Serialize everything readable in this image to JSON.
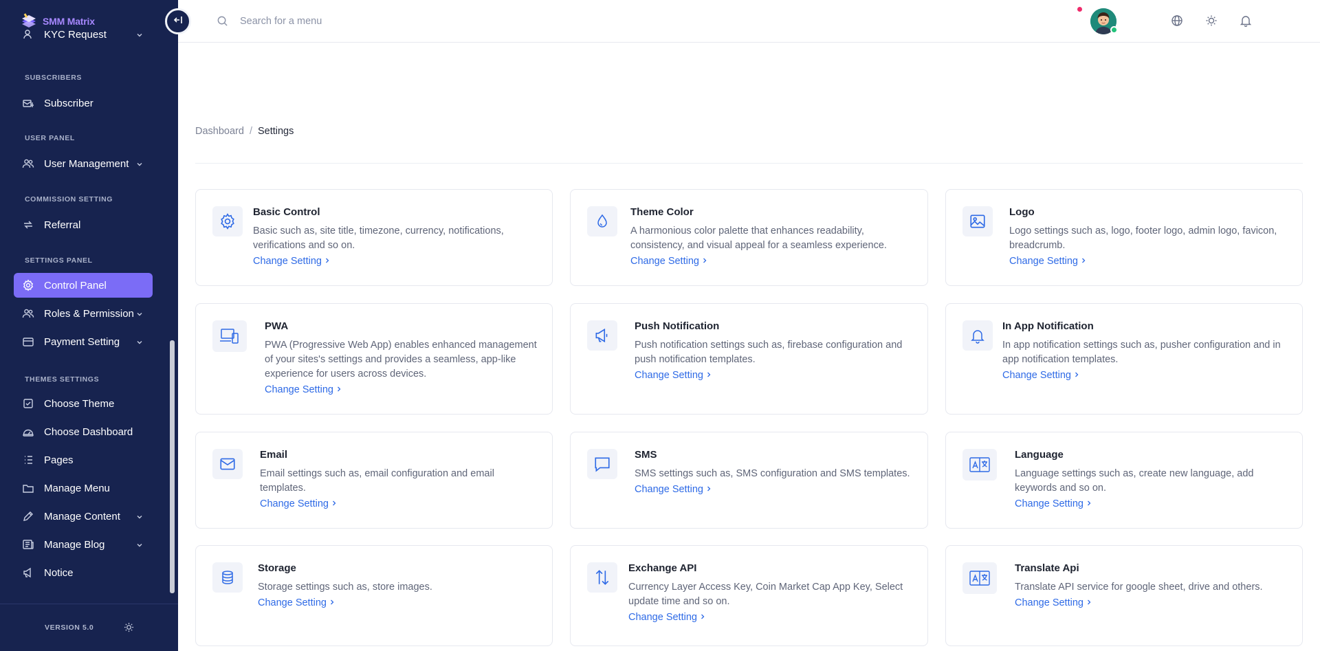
{
  "brand": {
    "name": "SMM Matrix"
  },
  "sidebar": {
    "partial_item": "KYC Request",
    "sections": [
      {
        "title": "SUBSCRIBERS"
      },
      {
        "title": "USER PANEL"
      },
      {
        "title": "COMMISSION SETTING"
      },
      {
        "title": "SETTINGS PANEL"
      },
      {
        "title": "THEMES SETTINGS"
      }
    ],
    "items": [
      {
        "label": "Subscriber",
        "icon": "subscriber-icon"
      },
      {
        "label": "User Management",
        "icon": "users-icon",
        "dropdown": true
      },
      {
        "label": "Referral",
        "icon": "referral-icon"
      },
      {
        "label": "Control Panel",
        "icon": "gear-icon",
        "active": true
      },
      {
        "label": "Roles & Permission",
        "icon": "roles-icon",
        "dropdown": true
      },
      {
        "label": "Payment Setting",
        "icon": "wallet-icon",
        "dropdown": true
      },
      {
        "label": "Choose Theme",
        "icon": "theme-icon"
      },
      {
        "label": "Choose Dashboard",
        "icon": "dashboard-icon"
      },
      {
        "label": "Pages",
        "icon": "pages-icon"
      },
      {
        "label": "Manage Menu",
        "icon": "folder-icon"
      },
      {
        "label": "Manage Content",
        "icon": "pencil-icon",
        "dropdown": true
      },
      {
        "label": "Manage Blog",
        "icon": "blog-icon",
        "dropdown": true
      },
      {
        "label": "Notice",
        "icon": "megaphone-icon"
      }
    ],
    "version": "VERSION 5.0"
  },
  "header": {
    "search_placeholder": "Search for a menu"
  },
  "breadcrumb": {
    "home": "Dashboard",
    "separator": "/",
    "current": "Settings"
  },
  "cards": [
    {
      "title": "Basic Control",
      "description": "Basic such as, site title, timezone, currency, notifications, verifications and so on.",
      "link": "Change Setting",
      "icon": "gear-icon"
    },
    {
      "title": "Theme Color",
      "description": "A harmonious color palette that enhances readability, consistency, and visual appeal for a seamless experience.",
      "link": "Change Setting",
      "icon": "droplet-icon"
    },
    {
      "title": "Logo",
      "description": "Logo settings such as, logo, footer logo, admin logo, favicon, breadcrumb.",
      "link": "Change Setting",
      "icon": "image-icon"
    },
    {
      "title": "PWA",
      "description": "PWA (Progressive Web App) enables enhanced management of your sites's settings and provides a seamless, app-like experience for users across devices.",
      "link": "Change Setting",
      "icon": "devices-icon"
    },
    {
      "title": "Push Notification",
      "description": "Push notification settings such as, firebase configuration and push notification templates.",
      "link": "Change Setting",
      "icon": "megaphone-icon"
    },
    {
      "title": "In App Notification",
      "description": "In app notification settings such as, pusher configuration and in app notification templates.",
      "link": "Change Setting",
      "icon": "bell-icon"
    },
    {
      "title": "Email",
      "description": "Email settings such as, email configuration and email templates.",
      "link": "Change Setting",
      "icon": "envelope-icon"
    },
    {
      "title": "SMS",
      "description": "SMS settings such as, SMS configuration and SMS templates.",
      "link": "Change Setting",
      "icon": "message-icon"
    },
    {
      "title": "Language",
      "description": "Language settings such as, create new language, add keywords and so on.",
      "link": "Change Setting",
      "icon": "translate-icon"
    },
    {
      "title": "Storage",
      "description": "Storage settings such as, store images.",
      "link": "Change Setting",
      "icon": "database-icon"
    },
    {
      "title": "Exchange API",
      "description": "Currency Layer Access Key, Coin Market Cap App Key, Select update time and so on.",
      "link": "Change Setting",
      "icon": "exchange-icon"
    },
    {
      "title": "Translate Api",
      "description": "Translate API service for google sheet, drive and others.",
      "link": "Change Setting",
      "icon": "translate-icon"
    }
  ],
  "colors": {
    "sidebar_bg": "#17234f",
    "active_item": "#7b6cf6",
    "link": "#2e6ae6",
    "brand_text": "#a788ff"
  }
}
